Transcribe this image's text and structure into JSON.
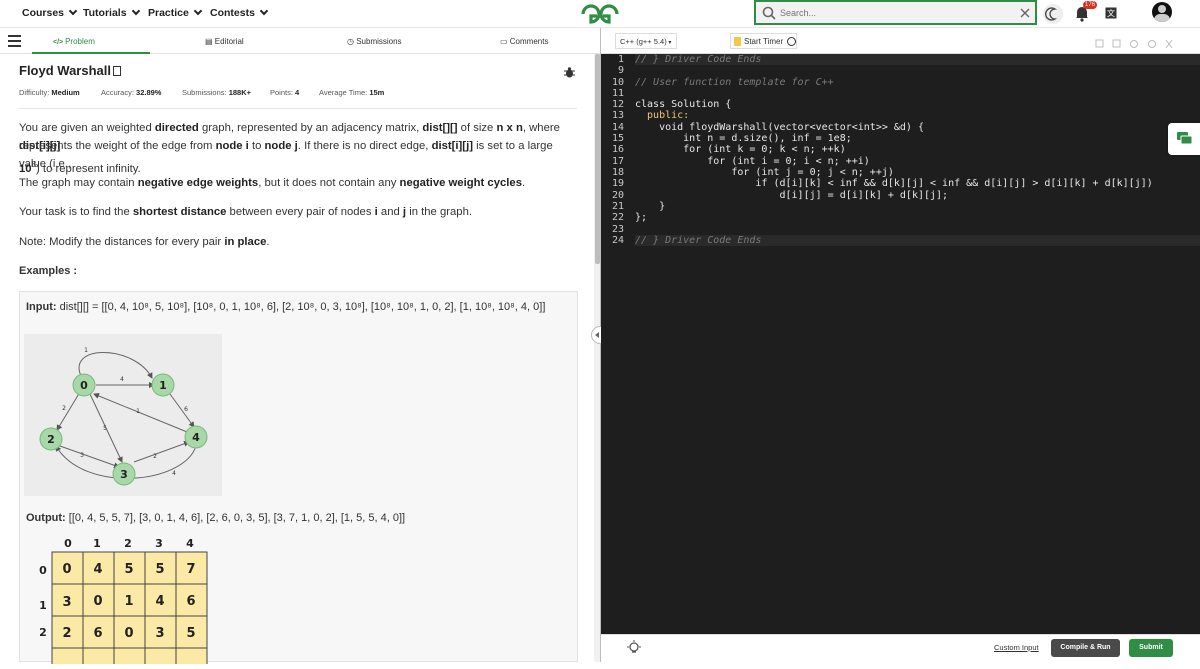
{
  "nav": {
    "items": [
      {
        "label": "Courses"
      },
      {
        "label": "Tutorials"
      },
      {
        "label": "Practice"
      },
      {
        "label": "Contests"
      }
    ],
    "search_placeholder": "Search...",
    "notification_count": "176"
  },
  "left_tabs": {
    "problem": "Problem",
    "editorial": "Editorial",
    "submissions": "Submissions",
    "comments": "Comments"
  },
  "problem": {
    "title": "Floyd Warshall",
    "difficulty_label": "Difficulty:",
    "difficulty": "Medium",
    "accuracy_label": "Accuracy:",
    "accuracy": "32.89%",
    "submissions_label": "Submissions:",
    "submissions": "188K+",
    "points_label": "Points:",
    "points": "4",
    "avg_time_label": "Average Time:",
    "avg_time": "15m"
  },
  "description": {
    "l1a": "You are given an weighted ",
    "l1b": "directed",
    "l1c": " graph, represented by an adjacency matrix, ",
    "l1d": "dist[][]",
    "l1e": " of size ",
    "l1f": "n x n",
    "l1g": ", where ",
    "l1h": "dist[i][j]",
    "l2a": "represents the weight of the edge from ",
    "l2b": "node i",
    "l2c": " to ",
    "l2d": "node j",
    "l2e": ". If there is no direct edge, ",
    "l2f": "dist[i][j]",
    "l2g": " is set to a large value (i.e.,",
    "l3a": "10",
    "l3b": "8",
    "l3c": ") to represent infinity.",
    "l4a": "The graph may contain ",
    "l4b": "negative edge weights",
    "l4c": ", but it does not contain any ",
    "l4d": "negative weight cycles",
    "l4e": ".",
    "task_a": "Your task is to find the ",
    "task_b": "shortest distance",
    "task_c": " between every pair of nodes ",
    "task_d": "i",
    "task_e": " and ",
    "task_f": "j",
    "task_g": " in the graph.",
    "note_a": "Note: Modify the distances for every pair ",
    "note_b": "in place",
    "note_c": "."
  },
  "examples": {
    "heading": "Examples :",
    "input_label": "Input:",
    "input_value": "dist[][] = [[0, 4, 10⁸, 5, 10⁸], [10⁸, 0, 1, 10⁸, 6], [2, 10⁸, 0, 3, 10⁸], [10⁸, 10⁸, 1, 0, 2], [1, 10⁸, 10⁸, 4, 0]]",
    "output_label": "Output:",
    "output_value": "[[0, 4, 5, 5, 7], [3, 0, 1, 4, 6], [2, 6, 0, 3, 5], [3, 7, 1, 0, 2], [1, 5, 5, 4, 0]]",
    "graph_nodes": [
      "0",
      "1",
      "2",
      "3",
      "4"
    ],
    "graph_edge_labels": [
      "1",
      "4",
      "2",
      "5",
      "1",
      "6",
      "3",
      "2",
      "4"
    ],
    "grid_col_headers": [
      "0",
      "1",
      "2",
      "3",
      "4"
    ],
    "grid_row_headers": [
      "0",
      "1",
      "2"
    ],
    "grid_rows": [
      [
        "0",
        "4",
        "5",
        "5",
        "7"
      ],
      [
        "3",
        "0",
        "1",
        "4",
        "6"
      ],
      [
        "2",
        "6",
        "0",
        "3",
        "5"
      ]
    ]
  },
  "editor": {
    "language": "C++ (g++ 5.4)",
    "timer": "Start Timer",
    "line_numbers": [
      "1",
      "9",
      "10",
      "11",
      "12",
      "13",
      "14",
      "15",
      "16",
      "17",
      "18",
      "19",
      "20",
      "21",
      "22",
      "23",
      "24"
    ],
    "lines": [
      "// } Driver Code Ends",
      "",
      "// User function template for C++",
      "",
      "class Solution {",
      "  public:",
      "    void floydWarshall(vector<vector<int>> &d) {",
      "        int n = d.size(), inf = 1e8;",
      "        for (int k = 0; k < n; ++k)",
      "            for (int i = 0; i < n; ++i)",
      "                for (int j = 0; j < n; ++j)",
      "                    if (d[i][k] < inf && d[k][j] < inf && d[i][j] > d[i][k] + d[k][j])",
      "                        d[i][j] = d[i][k] + d[k][j];",
      "    }",
      "};",
      "",
      "// } Driver Code Ends"
    ]
  },
  "footer": {
    "custom_input": "Custom Input",
    "compile_run": "Compile & Run",
    "submit": "Submit"
  },
  "colors": {
    "brand": "#2f8d46",
    "editor_bg": "#1e1e1e",
    "run_btn": "#4a4a4a"
  }
}
